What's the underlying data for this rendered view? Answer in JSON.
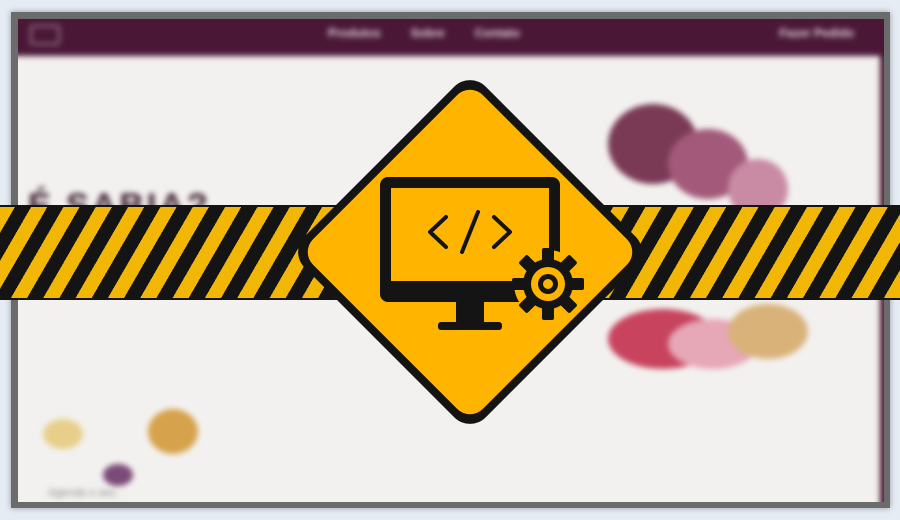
{
  "site": {
    "nav": {
      "links": [
        "Produtos",
        "Sobre",
        "Contato"
      ],
      "cta": "Fazer Pedido"
    },
    "hero_title": "É SABIA?",
    "footer_text": "Agenda o seu"
  },
  "sign": {
    "icon": "monitor-code-gear-icon",
    "code_glyph": "</>"
  },
  "colors": {
    "nav_bg": "#4a1836",
    "hazard_yellow": "#f2b705",
    "hazard_black": "#141414",
    "sign_fill": "#ffb400",
    "sign_border": "#141414",
    "frame": "#6b6b6b",
    "background": "#e6ecf4"
  }
}
